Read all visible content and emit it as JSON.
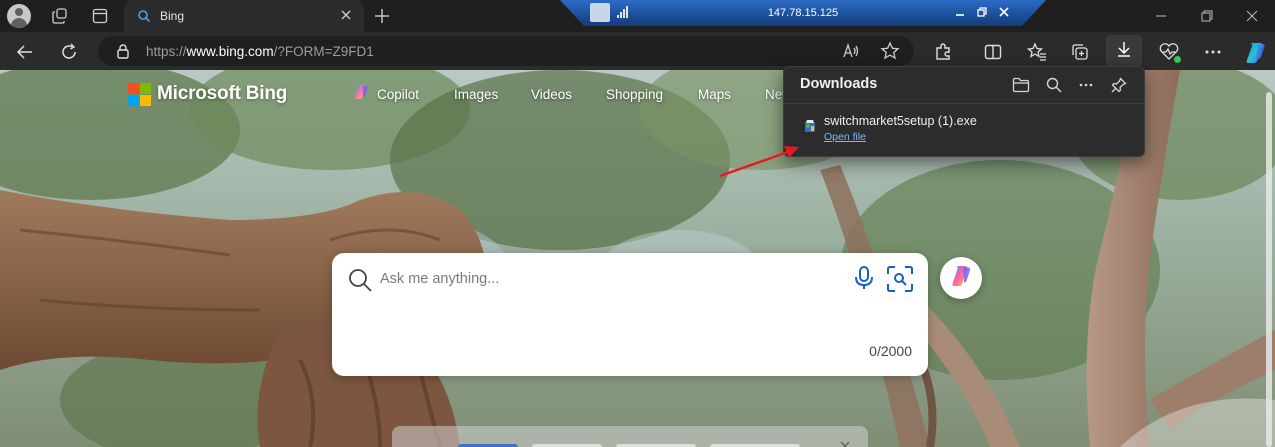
{
  "tab": {
    "title": "Bing"
  },
  "remote_session": {
    "host": "147.78.15.125"
  },
  "address_bar": {
    "url_prefix": "https://",
    "url_host": "www.bing.com",
    "url_path": "/?FORM=Z9FD1"
  },
  "bing": {
    "brand": "Microsoft Bing",
    "nav": [
      "Copilot",
      "Images",
      "Videos",
      "Shopping",
      "Maps",
      "New"
    ],
    "search": {
      "placeholder": "Ask me anything...",
      "char_count": "0/2000"
    }
  },
  "downloads": {
    "title": "Downloads",
    "items": [
      {
        "file_name": "switchmarket5setup (1).exe",
        "action": "Open file"
      }
    ]
  },
  "colors": {
    "ms_logo": [
      "#f25022",
      "#7fba00",
      "#00a4ef",
      "#ffb900"
    ],
    "annotation_arrow": "#e8191e",
    "link": "#79b8ff",
    "remote_bar": "#1b4f9c"
  },
  "icons": {
    "tab_bar": [
      "profile-avatar",
      "workspaces-icon",
      "tab-actions-icon",
      "search-favicon",
      "close-icon",
      "plus-icon"
    ],
    "nav_bar": [
      "back-arrow-icon",
      "refresh-icon",
      "lock-icon",
      "read-aloud-icon",
      "favorite-star-icon",
      "extensions-icon",
      "split-screen-icon",
      "favorites-icon",
      "collections-icon",
      "download-icon",
      "performance-icon",
      "more-icon",
      "copilot-icon"
    ],
    "downloads": [
      "open-folder-icon",
      "search-icon",
      "more-icon",
      "pin-icon"
    ]
  }
}
